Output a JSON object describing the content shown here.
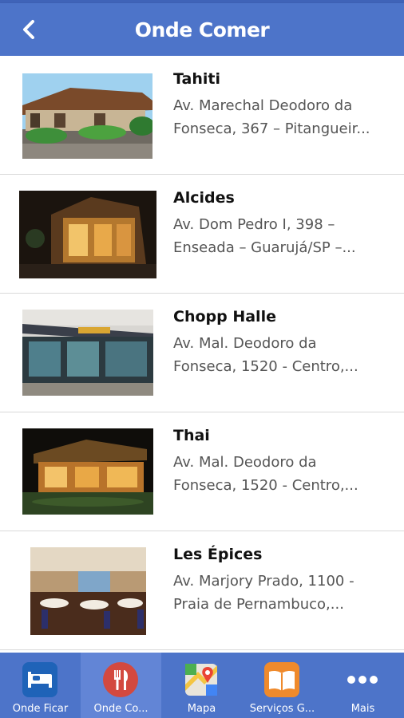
{
  "header": {
    "title": "Onde Comer",
    "back_icon": "chevron-left-icon"
  },
  "restaurants": [
    {
      "name": "Tahiti",
      "address_line1": "Av. Marechal Deodoro da",
      "address_line2": "Fonseca, 367 – Pitangueir..."
    },
    {
      "name": "Alcides",
      "address_line1": "Av. Dom Pedro I, 398 –",
      "address_line2": "Enseada – Guarujá/SP –..."
    },
    {
      "name": "Chopp Halle",
      "address_line1": "Av. Mal. Deodoro da",
      "address_line2": "Fonseca, 1520 - Centro,..."
    },
    {
      "name": "Thai",
      "address_line1": "Av. Mal. Deodoro da",
      "address_line2": "Fonseca, 1520 - Centro,..."
    },
    {
      "name": "Les Épices",
      "address_line1": "Av. Marjory Prado, 1100 -",
      "address_line2": "Praia de Pernambuco,..."
    }
  ],
  "tabs": [
    {
      "label": "Onde Ficar",
      "icon": "bed-icon"
    },
    {
      "label": "Onde Co...",
      "icon": "fork-knife-icon",
      "active": true
    },
    {
      "label": "Mapa",
      "icon": "map-icon"
    },
    {
      "label": "Serviços G...",
      "icon": "book-icon"
    },
    {
      "label": "Mais",
      "icon": "more-dots-icon"
    }
  ],
  "colors": {
    "header": "#4d74c9",
    "tabbar": "#4d74c9",
    "active_tab": "#6285d6",
    "divider": "#d9d9d9"
  }
}
